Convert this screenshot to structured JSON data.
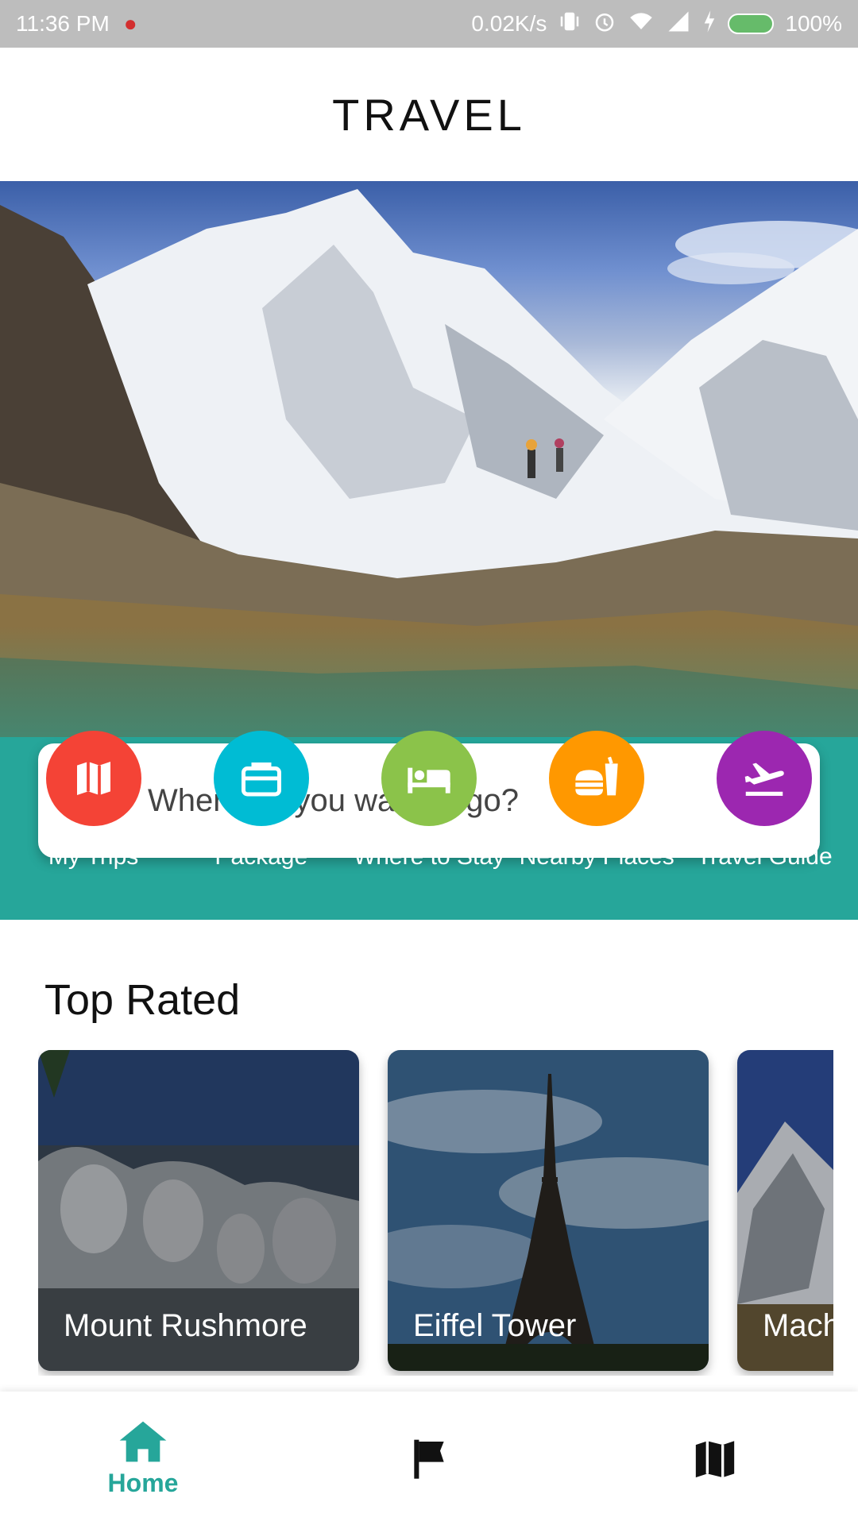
{
  "status_bar": {
    "time": "11:36 PM",
    "speed": "0.02K/s",
    "battery": "100%"
  },
  "app_bar": {
    "title": "TRAVEL"
  },
  "search": {
    "placeholder": "Where do you want to go?"
  },
  "categories": [
    {
      "label": "My Trips",
      "icon": "map-icon",
      "color": "#f44336"
    },
    {
      "label": "Package",
      "icon": "briefcase-icon",
      "color": "#00bcd4"
    },
    {
      "label": "Where to Stay",
      "icon": "hotel-bed-icon",
      "color": "#8bc34a"
    },
    {
      "label": "Nearby Places",
      "icon": "fastfood-icon",
      "color": "#ff9800"
    },
    {
      "label": "Travel Guide",
      "icon": "flight-takeoff-icon",
      "color": "#9c27b0"
    }
  ],
  "top_rated": {
    "title": "Top Rated",
    "cards": [
      {
        "label": "Mount Rushmore"
      },
      {
        "label": "Eiffel Tower"
      },
      {
        "label": "Mach"
      }
    ]
  },
  "bottom_nav": {
    "items": [
      {
        "label": "Home",
        "icon": "home-icon",
        "active": true
      },
      {
        "label": "",
        "icon": "flag-icon",
        "active": false
      },
      {
        "label": "",
        "icon": "map-icon",
        "active": false
      }
    ]
  },
  "colors": {
    "teal": "#26a69a",
    "status_bar": "#bdbdbd"
  }
}
